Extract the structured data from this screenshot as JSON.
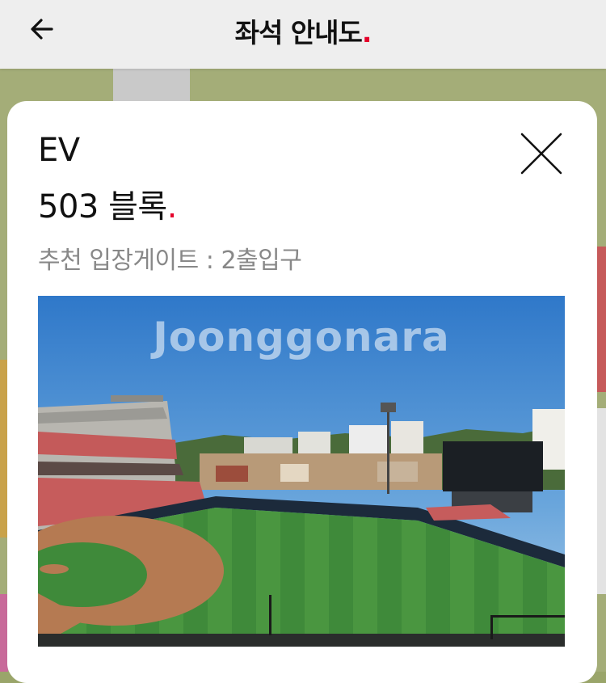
{
  "header": {
    "title": "좌석 안내도",
    "title_dot": ".",
    "back_label": "뒤로"
  },
  "modal": {
    "zone": "EV",
    "block": "503 블록",
    "block_dot": ".",
    "gate_label": "추천 입장게이트",
    "gate_separator": ":",
    "gate_value": "2출입구",
    "close_label": "닫기",
    "photo_watermark": "Joonggonara"
  },
  "colors": {
    "accent": "#e5002b",
    "header_bg": "#eeeeee",
    "text_primary": "#111111",
    "text_secondary": "#888888"
  }
}
